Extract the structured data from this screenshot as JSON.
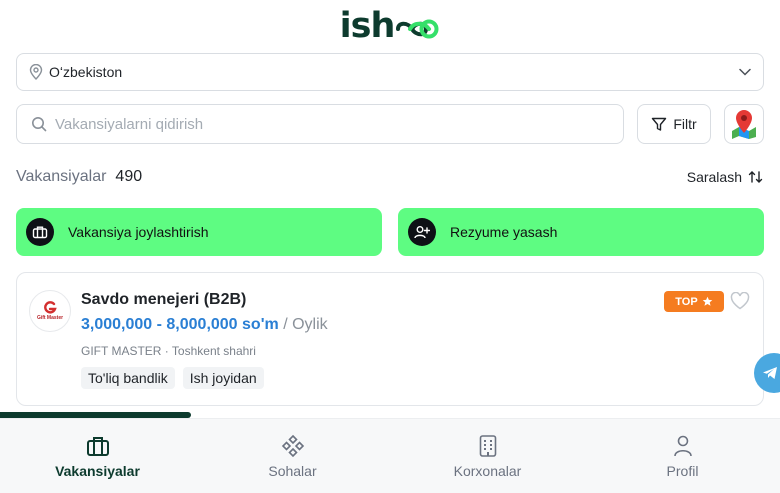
{
  "brand": {
    "name": "ish",
    "accent": "#5efc82",
    "dark": "#0d3b2e"
  },
  "region": {
    "value": "Oʻzbekiston"
  },
  "search": {
    "placeholder": "Vakansiyalarni qidirish"
  },
  "filter": {
    "label": "Filtr"
  },
  "listing": {
    "label": "Vakansiyalar",
    "count": "490",
    "sort_label": "Saralash"
  },
  "actions": {
    "post_vacancy": "Vakansiya joylashtirish",
    "create_resume": "Rezyume yasash"
  },
  "job": {
    "logo_text": "Gift Master",
    "title": "Savdo menejeri (B2B)",
    "salary": "3,000,000 - 8,000,000 so'm",
    "period": "/ Oylik",
    "company": "GIFT MASTER",
    "separator": "·",
    "location": "Toshkent shahri",
    "badge": "TOP",
    "tags": [
      "To'liq bandlik",
      "Ish joyidan"
    ]
  },
  "nav": [
    {
      "label": "Vakansiyalar",
      "icon": "briefcase-icon",
      "active": true
    },
    {
      "label": "Sohalar",
      "icon": "categories-icon",
      "active": false
    },
    {
      "label": "Korxonalar",
      "icon": "building-icon",
      "active": false
    },
    {
      "label": "Profil",
      "icon": "user-icon",
      "active": false
    }
  ]
}
